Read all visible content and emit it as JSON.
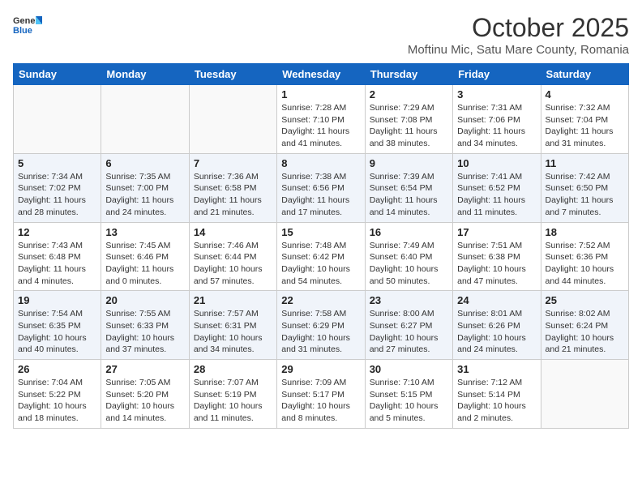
{
  "header": {
    "logo_general": "General",
    "logo_blue": "Blue",
    "month_title": "October 2025",
    "location": "Moftinu Mic, Satu Mare County, Romania"
  },
  "weekdays": [
    "Sunday",
    "Monday",
    "Tuesday",
    "Wednesday",
    "Thursday",
    "Friday",
    "Saturday"
  ],
  "weeks": [
    [
      {
        "day": "",
        "info": ""
      },
      {
        "day": "",
        "info": ""
      },
      {
        "day": "",
        "info": ""
      },
      {
        "day": "1",
        "info": "Sunrise: 7:28 AM\nSunset: 7:10 PM\nDaylight: 11 hours\nand 41 minutes."
      },
      {
        "day": "2",
        "info": "Sunrise: 7:29 AM\nSunset: 7:08 PM\nDaylight: 11 hours\nand 38 minutes."
      },
      {
        "day": "3",
        "info": "Sunrise: 7:31 AM\nSunset: 7:06 PM\nDaylight: 11 hours\nand 34 minutes."
      },
      {
        "day": "4",
        "info": "Sunrise: 7:32 AM\nSunset: 7:04 PM\nDaylight: 11 hours\nand 31 minutes."
      }
    ],
    [
      {
        "day": "5",
        "info": "Sunrise: 7:34 AM\nSunset: 7:02 PM\nDaylight: 11 hours\nand 28 minutes."
      },
      {
        "day": "6",
        "info": "Sunrise: 7:35 AM\nSunset: 7:00 PM\nDaylight: 11 hours\nand 24 minutes."
      },
      {
        "day": "7",
        "info": "Sunrise: 7:36 AM\nSunset: 6:58 PM\nDaylight: 11 hours\nand 21 minutes."
      },
      {
        "day": "8",
        "info": "Sunrise: 7:38 AM\nSunset: 6:56 PM\nDaylight: 11 hours\nand 17 minutes."
      },
      {
        "day": "9",
        "info": "Sunrise: 7:39 AM\nSunset: 6:54 PM\nDaylight: 11 hours\nand 14 minutes."
      },
      {
        "day": "10",
        "info": "Sunrise: 7:41 AM\nSunset: 6:52 PM\nDaylight: 11 hours\nand 11 minutes."
      },
      {
        "day": "11",
        "info": "Sunrise: 7:42 AM\nSunset: 6:50 PM\nDaylight: 11 hours\nand 7 minutes."
      }
    ],
    [
      {
        "day": "12",
        "info": "Sunrise: 7:43 AM\nSunset: 6:48 PM\nDaylight: 11 hours\nand 4 minutes."
      },
      {
        "day": "13",
        "info": "Sunrise: 7:45 AM\nSunset: 6:46 PM\nDaylight: 11 hours\nand 0 minutes."
      },
      {
        "day": "14",
        "info": "Sunrise: 7:46 AM\nSunset: 6:44 PM\nDaylight: 10 hours\nand 57 minutes."
      },
      {
        "day": "15",
        "info": "Sunrise: 7:48 AM\nSunset: 6:42 PM\nDaylight: 10 hours\nand 54 minutes."
      },
      {
        "day": "16",
        "info": "Sunrise: 7:49 AM\nSunset: 6:40 PM\nDaylight: 10 hours\nand 50 minutes."
      },
      {
        "day": "17",
        "info": "Sunrise: 7:51 AM\nSunset: 6:38 PM\nDaylight: 10 hours\nand 47 minutes."
      },
      {
        "day": "18",
        "info": "Sunrise: 7:52 AM\nSunset: 6:36 PM\nDaylight: 10 hours\nand 44 minutes."
      }
    ],
    [
      {
        "day": "19",
        "info": "Sunrise: 7:54 AM\nSunset: 6:35 PM\nDaylight: 10 hours\nand 40 minutes."
      },
      {
        "day": "20",
        "info": "Sunrise: 7:55 AM\nSunset: 6:33 PM\nDaylight: 10 hours\nand 37 minutes."
      },
      {
        "day": "21",
        "info": "Sunrise: 7:57 AM\nSunset: 6:31 PM\nDaylight: 10 hours\nand 34 minutes."
      },
      {
        "day": "22",
        "info": "Sunrise: 7:58 AM\nSunset: 6:29 PM\nDaylight: 10 hours\nand 31 minutes."
      },
      {
        "day": "23",
        "info": "Sunrise: 8:00 AM\nSunset: 6:27 PM\nDaylight: 10 hours\nand 27 minutes."
      },
      {
        "day": "24",
        "info": "Sunrise: 8:01 AM\nSunset: 6:26 PM\nDaylight: 10 hours\nand 24 minutes."
      },
      {
        "day": "25",
        "info": "Sunrise: 8:02 AM\nSunset: 6:24 PM\nDaylight: 10 hours\nand 21 minutes."
      }
    ],
    [
      {
        "day": "26",
        "info": "Sunrise: 7:04 AM\nSunset: 5:22 PM\nDaylight: 10 hours\nand 18 minutes."
      },
      {
        "day": "27",
        "info": "Sunrise: 7:05 AM\nSunset: 5:20 PM\nDaylight: 10 hours\nand 14 minutes."
      },
      {
        "day": "28",
        "info": "Sunrise: 7:07 AM\nSunset: 5:19 PM\nDaylight: 10 hours\nand 11 minutes."
      },
      {
        "day": "29",
        "info": "Sunrise: 7:09 AM\nSunset: 5:17 PM\nDaylight: 10 hours\nand 8 minutes."
      },
      {
        "day": "30",
        "info": "Sunrise: 7:10 AM\nSunset: 5:15 PM\nDaylight: 10 hours\nand 5 minutes."
      },
      {
        "day": "31",
        "info": "Sunrise: 7:12 AM\nSunset: 5:14 PM\nDaylight: 10 hours\nand 2 minutes."
      },
      {
        "day": "",
        "info": ""
      }
    ]
  ]
}
